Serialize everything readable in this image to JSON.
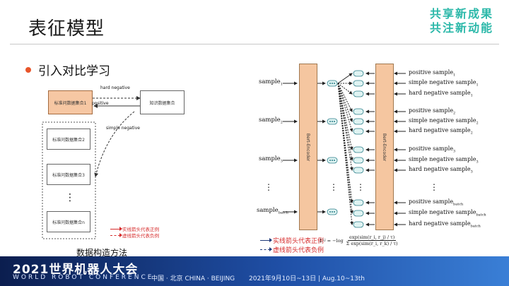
{
  "header": {
    "title": "表征模型",
    "slogan_line1": "共享新成果",
    "slogan_line2": "共注新动能"
  },
  "bullet": {
    "text": "引入对比学习"
  },
  "left_figure": {
    "main_box": "标准问数据集合1",
    "knowledge_box": "知识数据集合",
    "hard_negative": "hard negative",
    "positive": "positive",
    "simple_negative": "simple negative",
    "set2": "标准问数据集合2",
    "set3": "标准问数据集合3",
    "setn": "标准问数据集合n",
    "ellipsis": "⋮",
    "legend_solid": "实线箭头代表正例",
    "legend_dashed": "虚线箭头代表负例",
    "caption": "数据构造方法"
  },
  "right_figure": {
    "encoder_label": "Bert-Encoder",
    "samples": [
      {
        "base": "sample",
        "sub": "1"
      },
      {
        "base": "sample",
        "sub": "2"
      },
      {
        "base": "sample",
        "sub": "3"
      },
      {
        "base": "sample",
        "sub": "batch"
      }
    ],
    "ellipsis": "⋮",
    "outputs": [
      {
        "base": "positive sample",
        "sub": "1"
      },
      {
        "base": "simple negative sample",
        "sub": "1"
      },
      {
        "base": "hard negative sample",
        "sub": "1"
      },
      {
        "base": "positive sample",
        "sub": "2"
      },
      {
        "base": "simple negative sample",
        "sub": "2"
      },
      {
        "base": "hard negative sample",
        "sub": "2"
      },
      {
        "base": "positive sample",
        "sub": "3"
      },
      {
        "base": "simple negative sample",
        "sub": "3"
      },
      {
        "base": "hard negative sample",
        "sub": "3"
      },
      {
        "base": "positive sample",
        "sub": "batch"
      },
      {
        "base": "simple negative sample",
        "sub": "batch"
      },
      {
        "base": "hard negative sample",
        "sub": "batch"
      }
    ],
    "legend_solid": "实线箭头代表正例",
    "legend_dashed": "虚线箭头代表负例",
    "formula_lhs": "L",
    "formula_sub": "i,j",
    "formula_eq": " = −log",
    "formula_num": "exp(sim(r_i, r_j) / τ)",
    "formula_den": "Σ exp(sim(r_i, r_k) / τ)"
  },
  "footer": {
    "logo": "2021世界机器人大会",
    "subtitle": "WORLD ROBOT CONFERENCE",
    "location": "中国 · 北京  CHINA · BEIJING",
    "date": "2021年9月10日~13日 | Aug.10~13th"
  }
}
